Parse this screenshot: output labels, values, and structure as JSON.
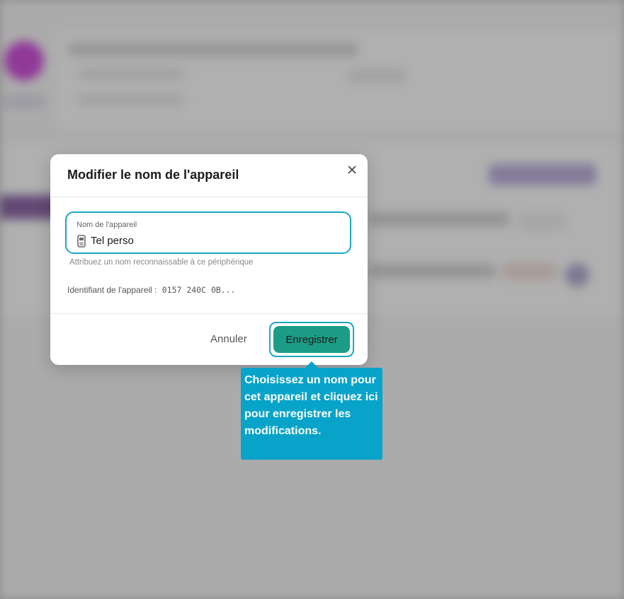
{
  "modal": {
    "title": "Modifier le nom de l'appareil",
    "close_icon": "close-icon",
    "field": {
      "label": "Nom de l'appareil",
      "value": "Tel perso",
      "icon": "phone-icon",
      "hint": "Attribuez un nom reconnaissable à ce périphérique"
    },
    "device_id": {
      "label": "Identifiant de l'appareil :",
      "value": "0157 240C 0B..."
    },
    "actions": {
      "cancel_label": "Annuler",
      "save_label": "Enregistrer"
    }
  },
  "tooltip": {
    "text": "Choisissez un nom pour cet appareil et cliquez ici pour enregistrer les modifications."
  },
  "colors": {
    "focus_border": "#19a8bf",
    "save_button": "#1c9c86",
    "tooltip_bg": "#07a3c9",
    "background_avatar": "#c21bd0"
  }
}
